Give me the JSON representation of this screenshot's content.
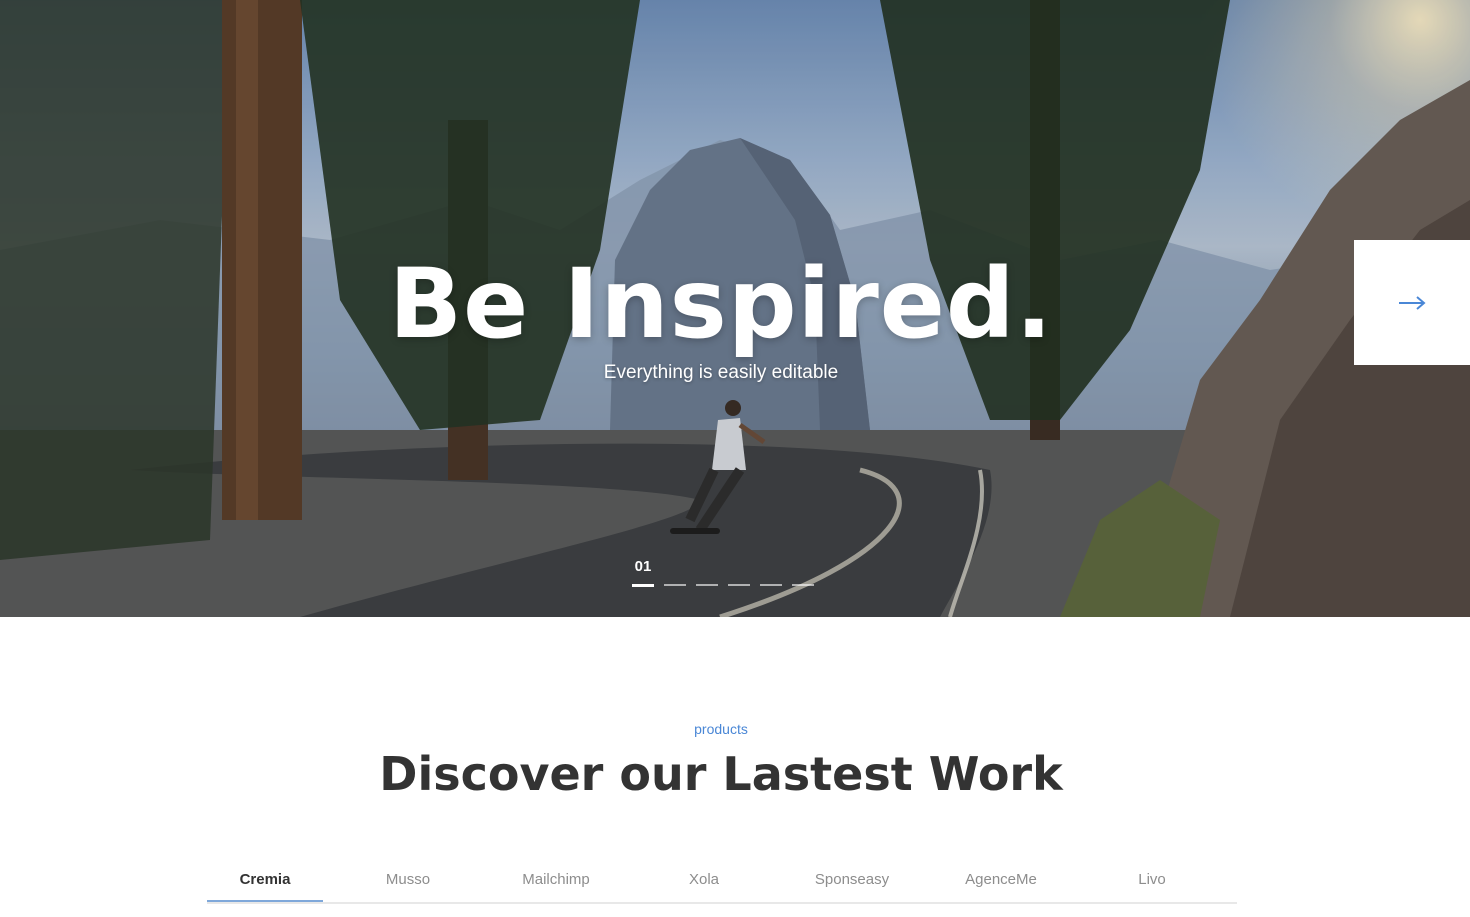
{
  "hero": {
    "title": "Be Inspired.",
    "subtitle": "Everything is easily editable",
    "slide_number": "01",
    "total_slides": 6,
    "active_slide": 1,
    "next_icon": "arrow-right-icon",
    "accent_color": "#4a87d6"
  },
  "products": {
    "eyebrow": "products",
    "title": "Discover our Lastest Work",
    "tabs": [
      {
        "label": "Cremia"
      },
      {
        "label": "Musso"
      },
      {
        "label": "Mailchimp"
      },
      {
        "label": "Xola"
      },
      {
        "label": "Sponseasy"
      },
      {
        "label": "AgenceMe"
      },
      {
        "label": "Livo"
      }
    ],
    "active_tab": 0,
    "tab_underline_color": "#7fa8da"
  }
}
